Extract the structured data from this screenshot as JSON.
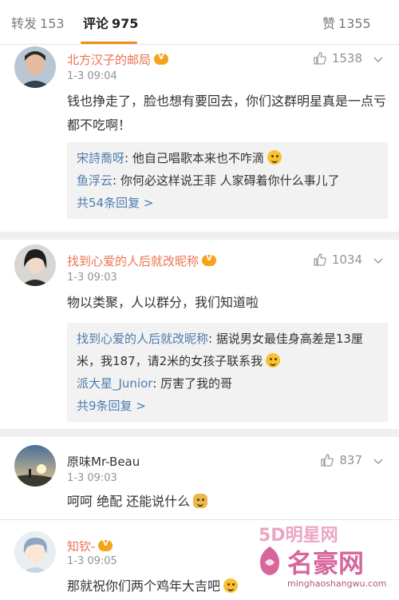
{
  "tabs": [
    {
      "label": "转发",
      "count": "153"
    },
    {
      "label": "评论",
      "count": "975"
    },
    {
      "label": "赞",
      "count": "1355"
    }
  ],
  "comments": [
    {
      "user": "北方汉子的邮局",
      "time": "1-3 09:04",
      "likes": "1538",
      "text": "钱也挣走了，脸也想有要回去，你们这群明星真是一点亏都不吃啊！",
      "replies": [
        {
          "name": "宋詩喬呀",
          "text": ": 他自己唱歌本来也不咋滴"
        },
        {
          "name": "鱼浮云",
          "text": ": 你何必这样说王菲 人家碍着你什么事儿了"
        }
      ],
      "more": "共54条回复 >"
    },
    {
      "user": "找到心爱的人后就改昵称",
      "time": "1-3 09:03",
      "likes": "1034",
      "text": "物以类聚，人以群分，我们知道啦",
      "replies": [
        {
          "name": "找到心爱的人后就改昵称",
          "text": ": 据说男女最佳身高差是13厘米，我187，请2米的女孩子联系我"
        },
        {
          "name": "派大星_Junior",
          "text": ": 厉害了我的哥"
        }
      ],
      "more": "共9条回复 >"
    },
    {
      "user": "原味Mr-Beau",
      "time": "1-3 09:03",
      "likes": "837",
      "text": "呵呵 绝配 还能说什么"
    },
    {
      "user": "知钦-",
      "time": "1-3 09:05",
      "text": "那就祝你们两个鸡年大吉吧"
    }
  ],
  "watermark": {
    "brand_top": "5D明星网",
    "brand_main": "名豪网",
    "url": "minghaoshangwu.com"
  }
}
